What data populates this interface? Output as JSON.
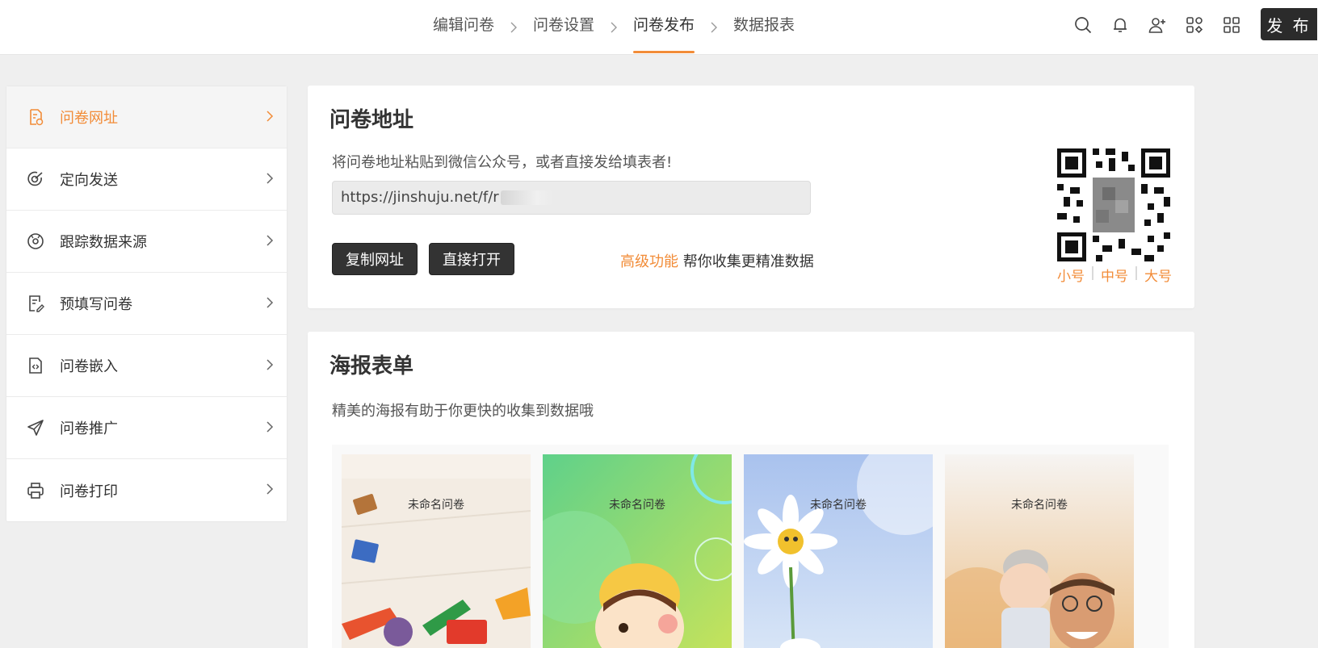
{
  "header": {
    "steps": [
      {
        "label": "编辑问卷"
      },
      {
        "label": "问卷设置"
      },
      {
        "label": "问卷发布"
      },
      {
        "label": "数据报表"
      }
    ],
    "active_step": "问卷发布",
    "icons": [
      "search-icon",
      "bell-icon",
      "add-user-icon",
      "apps-icon",
      "qrcode-grid-icon"
    ],
    "publish_label": "发 布"
  },
  "sidebar": {
    "items": [
      {
        "label": "问卷网址",
        "icon": "link-doc-icon",
        "active": true
      },
      {
        "label": "定向发送",
        "icon": "target-icon"
      },
      {
        "label": "跟踪数据来源",
        "icon": "source-icon"
      },
      {
        "label": "预填写问卷",
        "icon": "prefill-icon"
      },
      {
        "label": "问卷嵌入",
        "icon": "embed-code-icon"
      },
      {
        "label": "问卷推广",
        "icon": "send-plane-icon"
      },
      {
        "label": "问卷打印",
        "icon": "printer-icon"
      }
    ]
  },
  "url_card": {
    "title": "问卷地址",
    "description": "将问卷地址粘贴到微信公众号，或者直接发给填表者!",
    "url_value": "https://jinshuju.net/f/r",
    "copy_label": "复制网址",
    "open_label": "直接打开",
    "advanced_link": "高级功能",
    "advanced_text": " 帮你收集更精准数据",
    "qr_sizes": [
      "小号",
      "中号",
      "大号"
    ]
  },
  "poster_card": {
    "title": "海报表单",
    "description": "精美的海报有助于你更快的收集到数据哦",
    "posters": [
      {
        "title": "未命名问卷",
        "theme": "toys"
      },
      {
        "title": "未命名问卷",
        "theme": "green-kid"
      },
      {
        "title": "未命名问卷",
        "theme": "daisy"
      },
      {
        "title": "未命名问卷",
        "theme": "father-baby"
      }
    ]
  },
  "colors": {
    "accent": "#f28c38",
    "dark_button": "#2b2b2b",
    "page_bg": "#efefef"
  }
}
